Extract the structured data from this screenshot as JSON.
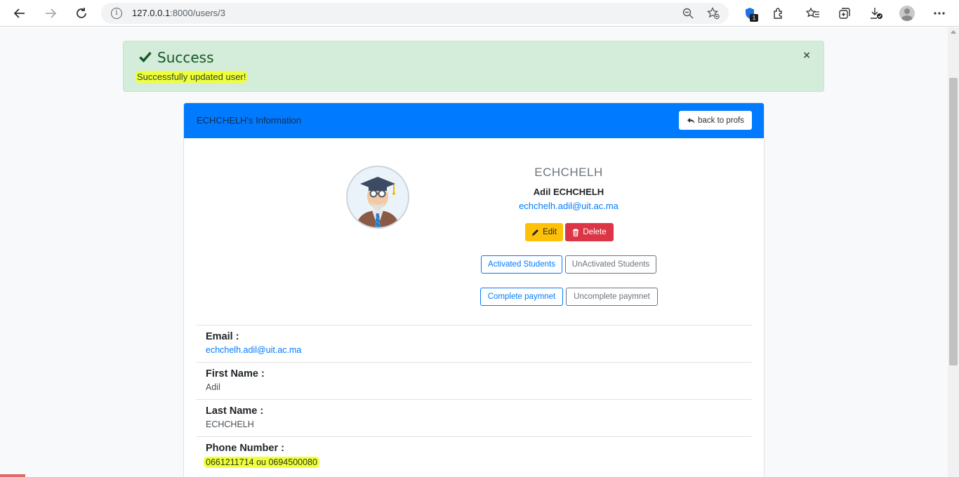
{
  "browser": {
    "url_host": "127.0.0.1",
    "url_path": ":8000/users/3",
    "extension_badge": "1"
  },
  "alert": {
    "title": "Success",
    "message": "Successfully updated user!",
    "close": "×"
  },
  "card": {
    "header_title": "ECHCHELH's Information",
    "back_button": "back to profs"
  },
  "profile": {
    "username": "ECHCHELH",
    "full_name": "Adil ECHCHELH",
    "email": "echchelh.adil@uit.ac.ma"
  },
  "actions": {
    "edit": "Edit",
    "delete": "Delete",
    "activated_students": "Activated Students",
    "unactivated_students": "UnActivated Students",
    "complete_payment": "Complete paymnet",
    "uncomplete_payment": "Uncomplete paymnet"
  },
  "details": [
    {
      "label": "Email :",
      "value": "echchelh.adil@uit.ac.ma"
    },
    {
      "label": "First Name :",
      "value": "Adil"
    },
    {
      "label": "Last Name :",
      "value": "ECHCHELH"
    },
    {
      "label": "Phone Number :",
      "value": "0661211714 ou 0694500080"
    }
  ],
  "colors": {
    "primary": "#007bff",
    "success_bg": "#d4edda",
    "warning": "#ffc107",
    "danger": "#dc3545",
    "highlight": "#f0ff3a"
  }
}
